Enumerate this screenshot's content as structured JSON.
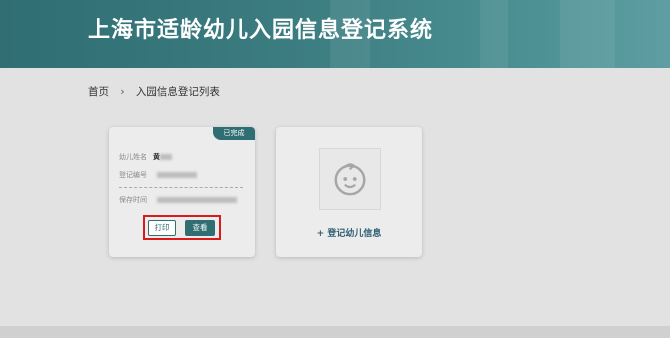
{
  "header": {
    "title": "上海市适龄幼儿入园信息登记系统"
  },
  "breadcrumb": {
    "home": "首页",
    "separator": "›",
    "current": "入园信息登记列表"
  },
  "record_card": {
    "status": "已完成",
    "fields": [
      {
        "label": "幼儿姓名",
        "value": "黄"
      },
      {
        "label": "登记编号",
        "value": ""
      },
      {
        "label": "保存时间",
        "value": ""
      }
    ],
    "print_label": "打印",
    "view_label": "查看"
  },
  "add_card": {
    "label": "+ 登记幼儿信息",
    "icon": "child-face-icon"
  },
  "colors": {
    "primary": "#2f6e72",
    "highlight": "#d81a1a",
    "background": "#e2e2e2"
  }
}
